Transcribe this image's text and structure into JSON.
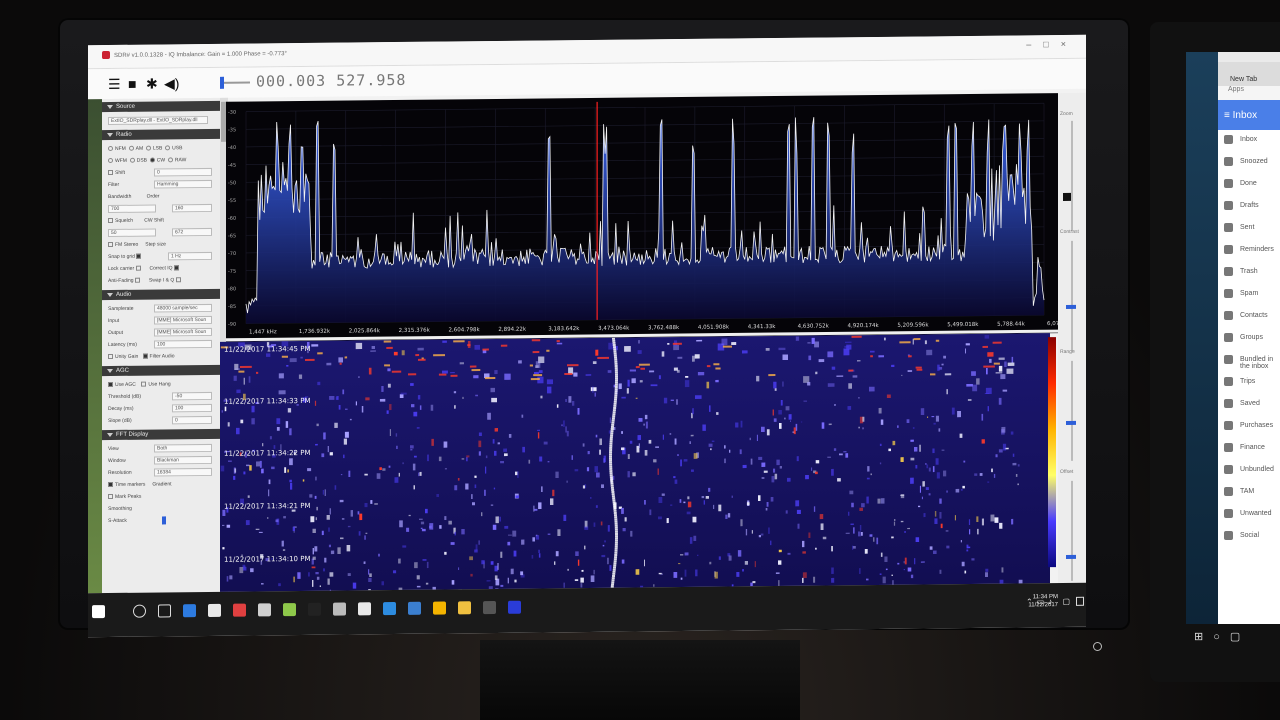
{
  "window": {
    "title": "SDR# v1.0.0.1328 - IQ Imbalance: Gain = 1.000 Phase = -0.773°",
    "controls": [
      "–",
      "□",
      "×"
    ]
  },
  "toolbar": {
    "icons": [
      "menu-icon",
      "stop-icon",
      "gear-icon",
      "speaker-icon"
    ],
    "frequency": "000.003 527.958"
  },
  "panel": {
    "source": {
      "title": "Source",
      "device": "ExtIO_SDRplay.dll - ExtIO_SDRplay.dll"
    },
    "radio": {
      "title": "Radio",
      "modes": [
        [
          "NFM",
          "AM",
          "LSB",
          "USB"
        ],
        [
          "WFM",
          "DSB",
          "CW",
          "RAW"
        ]
      ],
      "selected_mode": "CW",
      "shift_label": "Shift",
      "shift_value": "0",
      "filter_label": "Filter",
      "filter_value": "Hamming",
      "bandwidth_label": "Bandwidth",
      "bandwidth_value": "700",
      "order_label": "Order",
      "order_value": "160",
      "squelch_label": "Squelch",
      "squelch_value": "50",
      "cw_shift_label": "CW Shift",
      "cw_shift_value": "672",
      "fm_stereo_label": "FM Stereo",
      "step_size_label": "Step size",
      "snap_label": "Snap to grid",
      "snap_value": "1 Hz",
      "lock_carrier_label": "Lock carrier",
      "correct_iq_label": "Correct IQ",
      "anti_fading_label": "Anti-Fading",
      "swap_iq_label": "Swap I & Q"
    },
    "audio": {
      "title": "Audio",
      "samplerate_label": "Samplerate",
      "samplerate_value": "48000 sample/sec",
      "input_label": "Input",
      "input_value": "[MME] Microsoft Soun",
      "output_label": "Output",
      "output_value": "[MME] Microsoft Soun",
      "latency_label": "Latency (ms)",
      "latency_value": "100",
      "unity_gain_label": "Unity Gain",
      "filter_audio_label": "Filter Audio"
    },
    "agc": {
      "title": "AGC",
      "use_agc_label": "Use AGC",
      "use_hang_label": "Use Hang",
      "threshold_label": "Threshold (dB)",
      "threshold_value": "-50",
      "decay_label": "Decay (ms)",
      "decay_value": "100",
      "slope_label": "Slope (dB)",
      "slope_value": "0"
    },
    "fft": {
      "title": "FFT Display",
      "view_label": "View",
      "view_value": "Both",
      "window_label": "Window",
      "window_value": "Blackman",
      "resolution_label": "Resolution",
      "resolution_value": "16384",
      "time_markers_label": "Time markers",
      "gradient_label": "Gradient",
      "mark_peaks_label": "Mark Peaks",
      "smoothing_label": "Smoothing",
      "s_attack_label": "S-Attack"
    }
  },
  "spectrum": {
    "db_ticks": [
      "-30",
      "-35",
      "-40",
      "-45",
      "-50",
      "-55",
      "-60",
      "-65",
      "-70",
      "-75",
      "-80",
      "-85",
      "-90"
    ],
    "freq_ticks": [
      "1,447 kHz",
      "1,736.932k",
      "2,025.864k",
      "2,315.376k",
      "2,604.798k",
      "2,894.22k",
      "3,183.642k",
      "3,473.064k",
      "3,762.488k",
      "4,051.908k",
      "4,341.33k",
      "4,630.752k",
      "4,920.174k",
      "5,209.596k",
      "5,499.018k",
      "5,788.44k",
      "6,077.862k"
    ],
    "peaks_pct": [
      4,
      5.5,
      7,
      9,
      11,
      38,
      45,
      52,
      56,
      61,
      68,
      69,
      71,
      73,
      76,
      88,
      89,
      91,
      93,
      95,
      97,
      98
    ],
    "line_color": "#f4f4f4",
    "tuner_color": "#ff2020"
  },
  "waterfall": {
    "timestamps": [
      "11/22/2017 11:34:45 PM",
      "11/22/2017 11:34:33 PM",
      "11/22/2017 11:34:22 PM",
      "11/22/2017 11:34:21 PM",
      "11/22/2017 11:34:10 PM"
    ]
  },
  "rightcol": {
    "zoom_label": "Zoom",
    "contrast_label": "Contrast",
    "range_label": "Range",
    "offset_label": "Offset"
  },
  "taskbar": {
    "clock_time": "11:34 PM",
    "clock_date": "11/22/2017",
    "apps": [
      "start-icon",
      "search-icon",
      "task-view-icon",
      "edge-icon",
      "store-icon",
      "app-red-icon",
      "app-gear-icon",
      "app-green-icon",
      "cmd-icon",
      "app-tool-icon",
      "mail-icon",
      "ie-icon",
      "app-globe-icon",
      "chrome-icon",
      "explorer-icon",
      "calculator-icon",
      "sdr-icon"
    ],
    "app_colors": [
      "#ffffff",
      "#dddddd",
      "#dddddd",
      "#2d7be0",
      "#e8e8e8",
      "#e04040",
      "#d0d0d0",
      "#8ec84a",
      "#222222",
      "#bbbbbb",
      "#e8e8e8",
      "#2d8ce0",
      "#3b7fd0",
      "#f4b400",
      "#f0c040",
      "#555555",
      "#2a3cd8"
    ]
  },
  "right_monitor": {
    "tab": "New Tab",
    "app": "Inbox",
    "items": [
      "Inbox",
      "Snoozed",
      "Done",
      "Drafts",
      "Sent",
      "Reminders",
      "Trash",
      "Spam",
      "Contacts",
      "Groups",
      "Bundled in the inbox",
      "Trips",
      "Saved",
      "Purchases",
      "Finance",
      "Unbundled",
      "TAM",
      "Unwanted",
      "Social"
    ]
  }
}
